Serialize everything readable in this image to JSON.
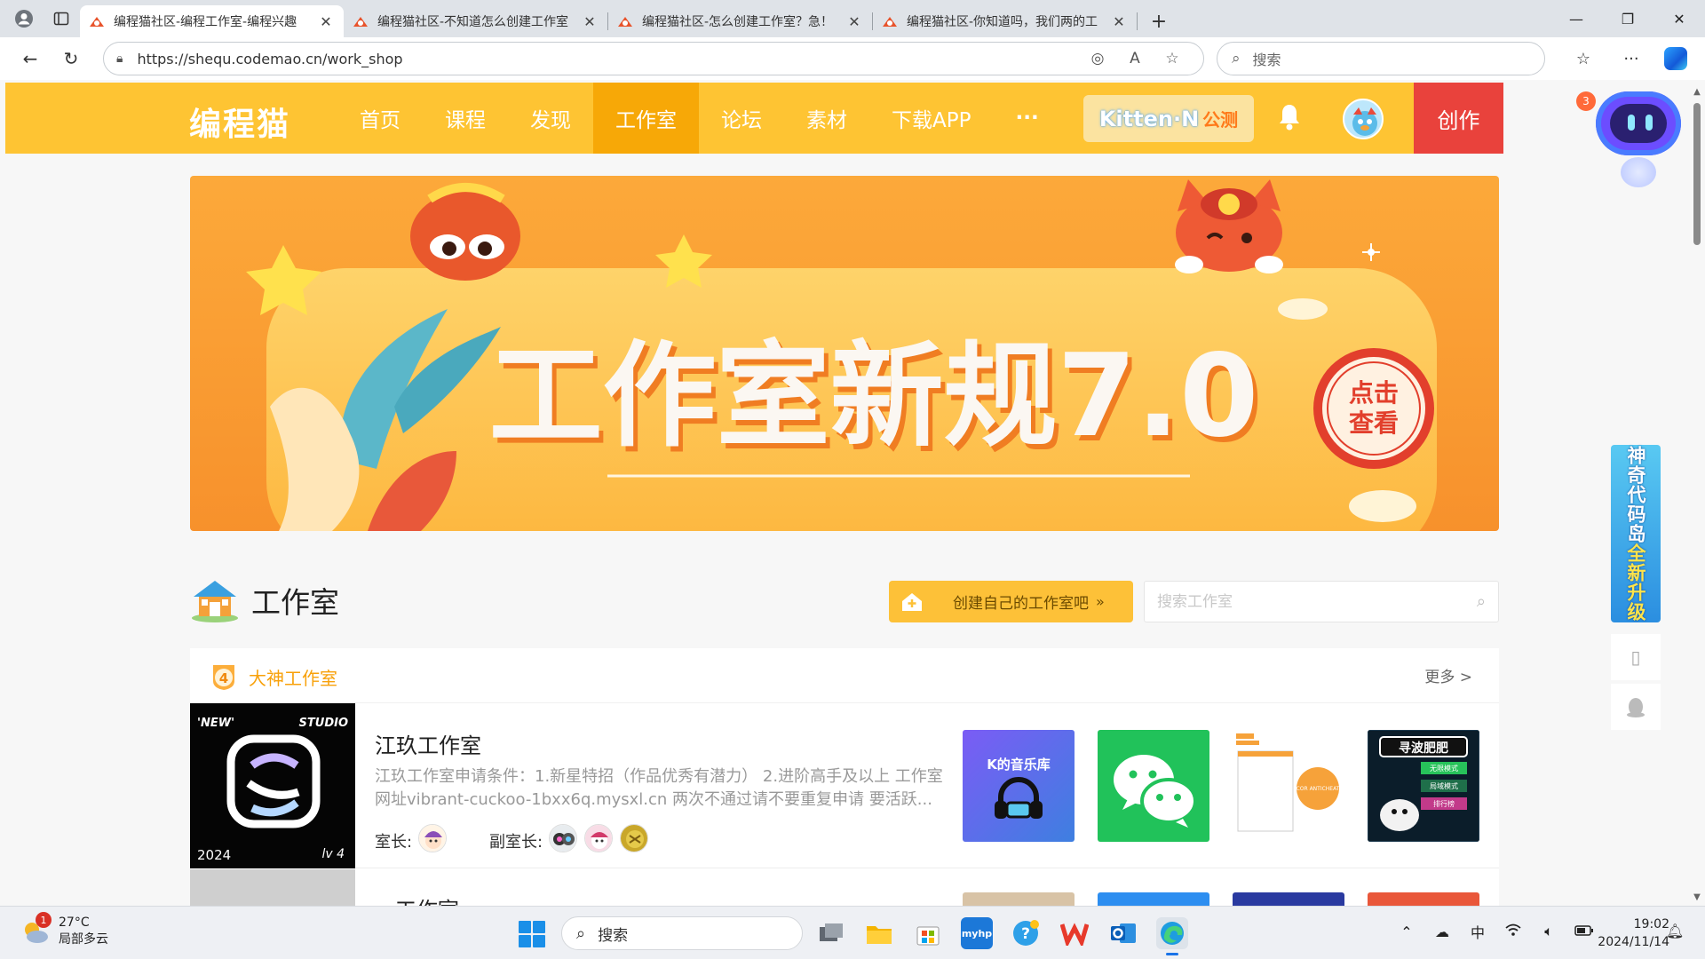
{
  "browser": {
    "tabs": [
      {
        "title": "编程猫社区-编程工作室-编程兴趣",
        "active": true
      },
      {
        "title": "编程猫社区-不知道怎么创建工作室",
        "active": false
      },
      {
        "title": "编程猫社区-怎么创建工作室？急！",
        "active": false
      },
      {
        "title": "编程猫社区-你知道吗，我们两的工",
        "active": false
      }
    ],
    "url": "https://shequ.codemao.cn/work_shop",
    "search_placeholder": "搜索"
  },
  "site": {
    "logo": "编程猫",
    "nav": [
      {
        "label": "首页"
      },
      {
        "label": "课程"
      },
      {
        "label": "发现"
      },
      {
        "label": "工作室",
        "active": true
      },
      {
        "label": "论坛"
      },
      {
        "label": "素材"
      },
      {
        "label": "下载APP"
      },
      {
        "label": "···"
      }
    ],
    "kitten": {
      "name": "Kitten·N",
      "tag": "公测"
    },
    "create_label": "创作",
    "robot_badge": "3"
  },
  "banner": {
    "headline": "工作室新规7.0",
    "cta_line1": "点击",
    "cta_line2": "查看"
  },
  "section": {
    "title": "工作室",
    "create_own_label": "创建自己的工作室吧",
    "create_own_arrow": "»",
    "search_placeholder": "搜索工作室"
  },
  "panel": {
    "title": "大神工作室",
    "rank": "4",
    "more_label": "更多 >",
    "rows": [
      {
        "name": "江玖工作室",
        "cover": {
          "tl": "'NEW'",
          "tr": "STUDIO",
          "bl": "2024",
          "br": "lv 4"
        },
        "description": "江玖工作室申请条件：1.新星特招（作品优秀有潜力） 2.进阶高手及以上 工作室网址vibrant-cuckoo-1bxx6q.mysxl.cn 两次不通过请不要重复申请 要活跃...",
        "owner_label": "室长:",
        "vice_label": "副室长:",
        "thumbnails": [
          {
            "label": "K的音乐库"
          },
          {
            "label": ""
          },
          {
            "label": "COR ANTICHEAT"
          },
          {
            "label": "寻波肥肥",
            "sub1": "无限模式",
            "sub2": "局域模式",
            "sub3": "排行榜"
          }
        ]
      },
      {
        "name": "...工作室"
      }
    ]
  },
  "side": {
    "ad_part1": "神奇代码岛",
    "ad_part2": "全新升级"
  },
  "taskbar": {
    "weather_temp": "27°C",
    "weather_desc": "局部多云",
    "weather_badge": "1",
    "search_placeholder": "搜索",
    "ime": "中",
    "time": "19:02",
    "date": "2024/11/14"
  }
}
